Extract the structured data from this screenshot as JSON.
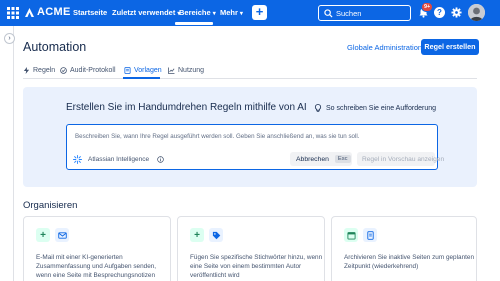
{
  "topnav": {
    "logo": "ACME",
    "items": [
      {
        "label": "Startseite",
        "has_chevron": false
      },
      {
        "label": "Zuletzt verwendet",
        "has_chevron": true
      },
      {
        "label": "Bereiche",
        "has_chevron": true
      },
      {
        "label": "Mehr",
        "has_chevron": true
      }
    ],
    "active_item": "Bereiche",
    "create_label": "+",
    "search_placeholder": "Suchen",
    "notification_badge": "9+",
    "help_label": "?"
  },
  "page": {
    "title": "Automation",
    "global_admin_label": "Globale Administration",
    "create_rule_label": "Regel erstellen"
  },
  "tabs": [
    {
      "label": "Regeln",
      "icon": "bolt-icon"
    },
    {
      "label": "Audit-Protokoll",
      "icon": "check-circle-icon"
    },
    {
      "label": "Vorlagen",
      "icon": "template-icon"
    },
    {
      "label": "Nutzung",
      "icon": "chart-icon"
    }
  ],
  "active_tab": "Vorlagen",
  "ai": {
    "heading": "Erstellen Sie im Handumdrehen Regeln mithilfe von AI",
    "prompt_link": "So schreiben Sie eine Aufforderung",
    "placeholder": "Beschreiben Sie, wann Ihre Regel ausgeführt werden soll. Geben Sie anschließend an, was sie tun soll.",
    "brand": "Atlassian Intelligence",
    "cancel_label": "Abbrechen",
    "cancel_key": "Esc",
    "preview_label": "Regel in Vorschau anzeigen"
  },
  "organize": {
    "title": "Organisieren",
    "cards": [
      {
        "icons": [
          "plus-icon",
          "mail-icon"
        ],
        "text": "E-Mail mit einer KI-generierten Zusammenfassung und Aufgaben senden, wenn eine Seite mit Besprechungsnotizen"
      },
      {
        "icons": [
          "plus-icon",
          "tag-icon"
        ],
        "text": "Fügen Sie spezifische Stichwörter hinzu, wenn eine Seite von einem bestimmten Autor veröffentlicht wird"
      },
      {
        "icons": [
          "calendar-icon",
          "archive-icon"
        ],
        "text": "Archivieren Sie inaktive Seiten zum geplanten Zeitpunkt (wiederkehrend)"
      }
    ]
  },
  "colors": {
    "brand_blue": "#0c66e4",
    "ai_panel_bg": "#eaf1fd",
    "badge_red": "#e2483d"
  }
}
